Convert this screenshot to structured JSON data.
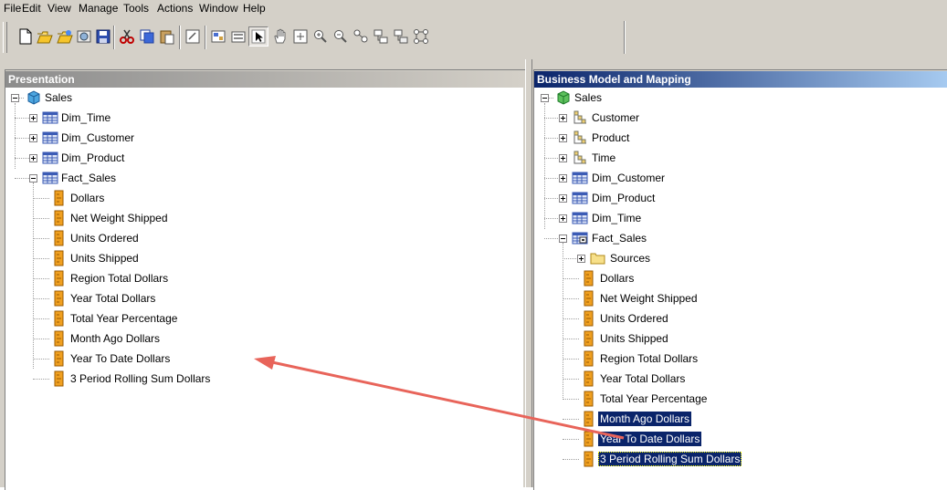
{
  "menu": [
    "File",
    "Edit",
    "View",
    "Manage",
    "Tools",
    "Actions",
    "Window",
    "Help"
  ],
  "toolbar_icons": [
    "new-icon",
    "open-icon",
    "open-online-icon",
    "import-icon",
    "save-icon",
    "cut-icon",
    "copy-icon",
    "paste-icon",
    "properties-icon",
    "new-object-icon",
    "query-icon",
    "select-pointer-icon",
    "pan-hand-icon",
    "zoom-fit-icon",
    "zoom-in-icon",
    "zoom-out-icon",
    "diagram-icon",
    "physical-diagram-icon",
    "business-diagram-icon",
    "join-icon"
  ],
  "left_panel": {
    "title": "Presentation",
    "root": "Sales",
    "tables": [
      "Dim_Time",
      "Dim_Customer",
      "Dim_Product",
      "Fact_Sales"
    ],
    "columns": [
      "Dollars",
      "Net Weight Shipped",
      "Units Ordered",
      "Units Shipped",
      "Region Total Dollars",
      "Year Total Dollars",
      "Total Year Percentage",
      "Month Ago Dollars",
      "Year To Date Dollars",
      "3 Period Rolling Sum Dollars"
    ]
  },
  "right_panel": {
    "title": "Business Model and Mapping",
    "root": "Sales",
    "hierarchies": [
      "Customer",
      "Product",
      "Time"
    ],
    "tables": [
      "Dim_Customer",
      "Dim_Product",
      "Dim_Time",
      "Fact_Sales"
    ],
    "folder": "Sources",
    "columns": [
      "Dollars",
      "Net Weight Shipped",
      "Units Ordered",
      "Units Shipped",
      "Region Total Dollars",
      "Year Total Dollars",
      "Total Year Percentage",
      "Month Ago Dollars",
      "Year To Date Dollars",
      "3 Period Rolling Sum Dollars"
    ],
    "selected": [
      "Month Ago Dollars",
      "Year To Date Dollars",
      "3 Period Rolling Sum Dollars"
    ]
  },
  "colors": {
    "selection": "#0a246a",
    "arrow": "#e8645a",
    "column_icon": "#f0a020",
    "table_icon": "#3b5bb5"
  }
}
